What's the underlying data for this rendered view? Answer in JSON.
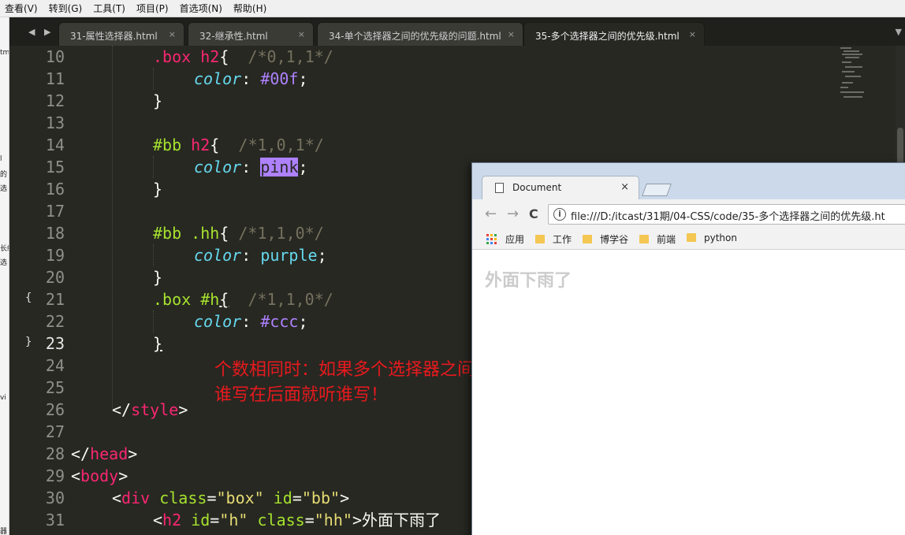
{
  "menu": [
    "查看(V)",
    "转到(G)",
    "工具(T)",
    "项目(P)",
    "首选项(N)",
    "帮助(H)"
  ],
  "left_strip_fragments": [
    "tm",
    "l",
    "的",
    "选",
    "长级",
    "选",
    "vi",
    "器"
  ],
  "tabs": [
    {
      "label": "31-属性选择器.html",
      "close": "×",
      "active": false
    },
    {
      "label": "32-继承性.html",
      "close": "×",
      "active": false
    },
    {
      "label": "34-单个选择器之间的优先级的问题.html",
      "close": "×",
      "active": false
    },
    {
      "label": "35-多个选择器之间的优先级.html",
      "close": "×",
      "active": true
    }
  ],
  "tab_nav": "◀ ▶",
  "tab_overflow": "▼",
  "line_numbers": [
    "10",
    "11",
    "12",
    "13",
    "14",
    "15",
    "16",
    "17",
    "18",
    "19",
    "20",
    "21",
    "22",
    "23",
    "24",
    "25",
    "26",
    "27",
    "28",
    "29",
    "30",
    "31"
  ],
  "fold_marks": {
    "line21": "{",
    "line23": "}"
  },
  "code": {
    "l10_sel": ".box",
    "l10_tag": "h2",
    "l10_brace": "{",
    "l10_cm": "/*0,1,1*/",
    "l11_prop": "color",
    "l11_colon": ":",
    "l11_val": "#00f",
    "l11_semi": ";",
    "l12": "}",
    "l14_sel": "#bb",
    "l14_tag": "h2",
    "l14_brace": "{",
    "l14_cm": "/*1,0,1*/",
    "l15_prop": "color",
    "l15_colon": ":",
    "l15_val": "pink",
    "l15_semi": ";",
    "l16": "}",
    "l18_sel": "#bb .hh",
    "l18_brace": "{",
    "l18_cm": "/*1,1,0*/",
    "l19_prop": "color",
    "l19_colon": ":",
    "l19_val": "purple",
    "l19_semi": ";",
    "l20": "}",
    "l21_sel": ".box #h",
    "l21_brace": "{",
    "l21_cm": "/*1,1,0*/",
    "l22_prop": "color",
    "l22_colon": ":",
    "l22_val": "#ccc",
    "l22_semi": ";",
    "l23": "}",
    "l26_open": "</",
    "l26_tag": "style",
    "l26_close": ">",
    "l28_open": "</",
    "l28_tag": "head",
    "l28_close": ">",
    "l29_open": "<",
    "l29_tag": "body",
    "l29_close": ">",
    "l30_open": "<",
    "l30_tag": "div",
    "l30_a1": "class",
    "l30_eq1": "=",
    "l30_v1": "\"box\"",
    "l30_a2": "id",
    "l30_eq2": "=",
    "l30_v2": "\"bb\"",
    "l30_close": ">",
    "l31_open": "<",
    "l31_tag": "h2",
    "l31_a1": "id",
    "l31_eq1": "=",
    "l31_v1": "\"h\"",
    "l31_a2": "class",
    "l31_eq2": "=",
    "l31_v2": "\"hh\"",
    "l31_close": ">",
    "l31_text": "外面下雨了"
  },
  "annotation": {
    "line1": "个数相同时：如果多个选择器之间的个数相同时要观察CSS代码的书写顺序",
    "line2": "谁写在后面就听谁写！",
    "color": "#e8191d"
  },
  "browser": {
    "tab_title": "Document",
    "tab_close": "×",
    "back": "←",
    "forward": "→",
    "reload": "C",
    "info": "i",
    "url": "file:///D:/itcast/31期/04-CSS/code/35-多个选择器之间的优先级.ht",
    "bookmarks": [
      "应用",
      "工作",
      "博学谷",
      "前端",
      "python"
    ],
    "heading": "外面下雨了",
    "heading_color": "#cccccc"
  },
  "theme": {
    "background": "#272822",
    "selector": "#f92672",
    "attribute": "#a6e22e",
    "string": "#e6db74",
    "comment": "#75715e",
    "property": "#66d9ef",
    "number": "#ae81ff"
  }
}
